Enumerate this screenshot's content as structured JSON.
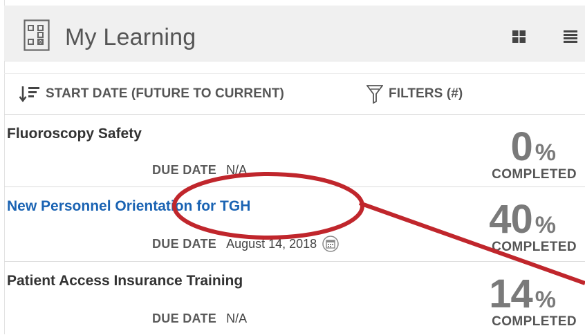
{
  "header": {
    "title": "My Learning",
    "grid_view_icon": "grid-view-icon",
    "list_view_icon": "list-view-icon"
  },
  "toolbar": {
    "sort_label": "START DATE (FUTURE TO CURRENT)",
    "filter_label": "FILTERS (#)"
  },
  "courses": [
    {
      "title": "Fluoroscopy Safety",
      "due_label": "DUE DATE",
      "due_value": "N/A",
      "percent": "0",
      "percent_sign": "%",
      "completed_label": "COMPLETED"
    },
    {
      "title": "New Personnel Orientation for TGH",
      "due_label": "DUE DATE",
      "due_value": "August 14, 2018",
      "percent": "40",
      "percent_sign": "%",
      "completed_label": "COMPLETED"
    },
    {
      "title": "Patient Access Insurance Training",
      "due_label": "DUE DATE",
      "due_value": "N/A",
      "percent": "14",
      "percent_sign": "%",
      "completed_label": "COMPLETED"
    }
  ],
  "colors": {
    "link": "#1a63b3",
    "annotation": "#c0262c",
    "header_bg": "#f0f0f0"
  }
}
